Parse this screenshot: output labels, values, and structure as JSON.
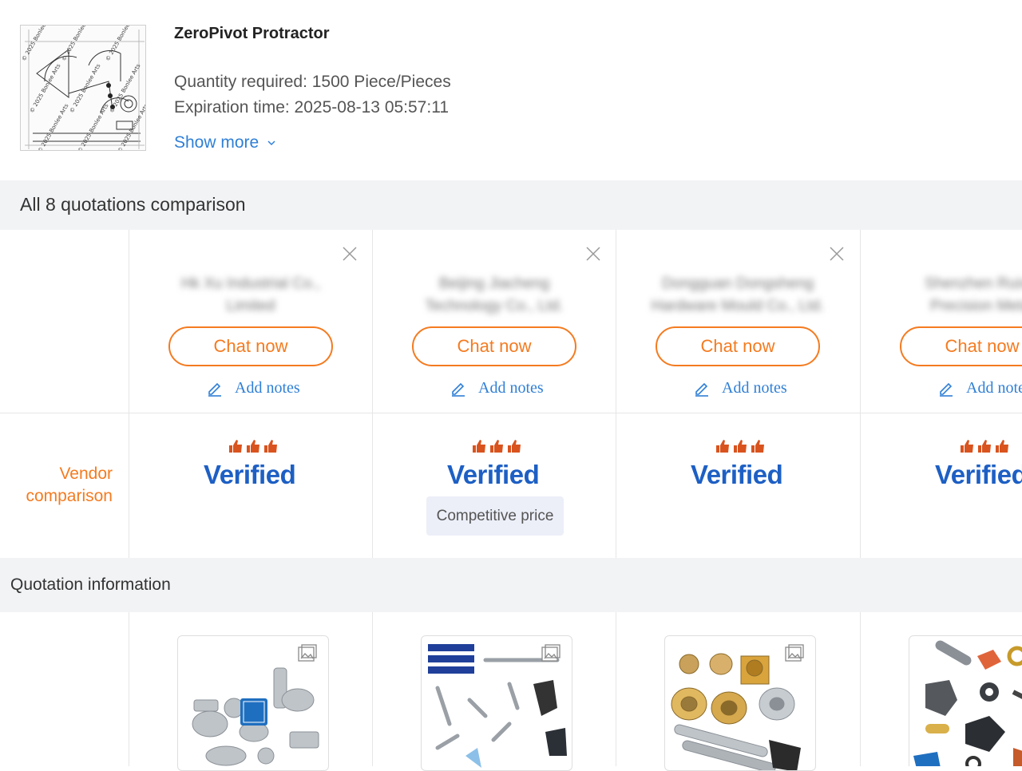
{
  "product": {
    "title": "ZeroPivot Protractor",
    "quantity": "Quantity required: 1500 Piece/Pieces",
    "expiration": "Expiration time: 2025-08-13 05:57:11",
    "show_more": "Show more",
    "thumbnail_watermark": "© 2025 Bonlee Arts"
  },
  "comparison_header": "All 8 quotations comparison",
  "vendor_comparison_label_line1": "Vendor",
  "vendor_comparison_label_line2": "comparison",
  "quotation_header": "Quotation information",
  "vendors": [
    {
      "name_line1": "Hk Xu Industrial Co.,",
      "name_line2": "Limited",
      "chat": "Chat now",
      "notes": "Add notes",
      "verified": "Verified",
      "badge": ""
    },
    {
      "name_line1": "Beijing Jiacheng",
      "name_line2": "Technology Co., Ltd.",
      "chat": "Chat now",
      "notes": "Add notes",
      "verified": "Verified",
      "badge": "Competitive price"
    },
    {
      "name_line1": "Dongguan Dongsheng",
      "name_line2": "Hardware Mould Co., Ltd.",
      "chat": "Chat now",
      "notes": "Add notes",
      "verified": "Verified",
      "badge": ""
    },
    {
      "name_line1": "Shenzhen Ruixin",
      "name_line2": "Precision Metal",
      "chat": "Chat now",
      "notes": "Add notes",
      "verified": "Verified",
      "badge": ""
    }
  ],
  "colors": {
    "accent_orange": "#f47b20",
    "link_blue": "#2f7fd6",
    "verified_blue": "#1d5fc4",
    "section_bg": "#f2f3f5"
  },
  "icons": {
    "close": "close-icon",
    "edit": "pencil-icon",
    "image": "image-icon",
    "chevron": "chevron-down-icon",
    "thumbs": "thumbs-up-icon"
  }
}
